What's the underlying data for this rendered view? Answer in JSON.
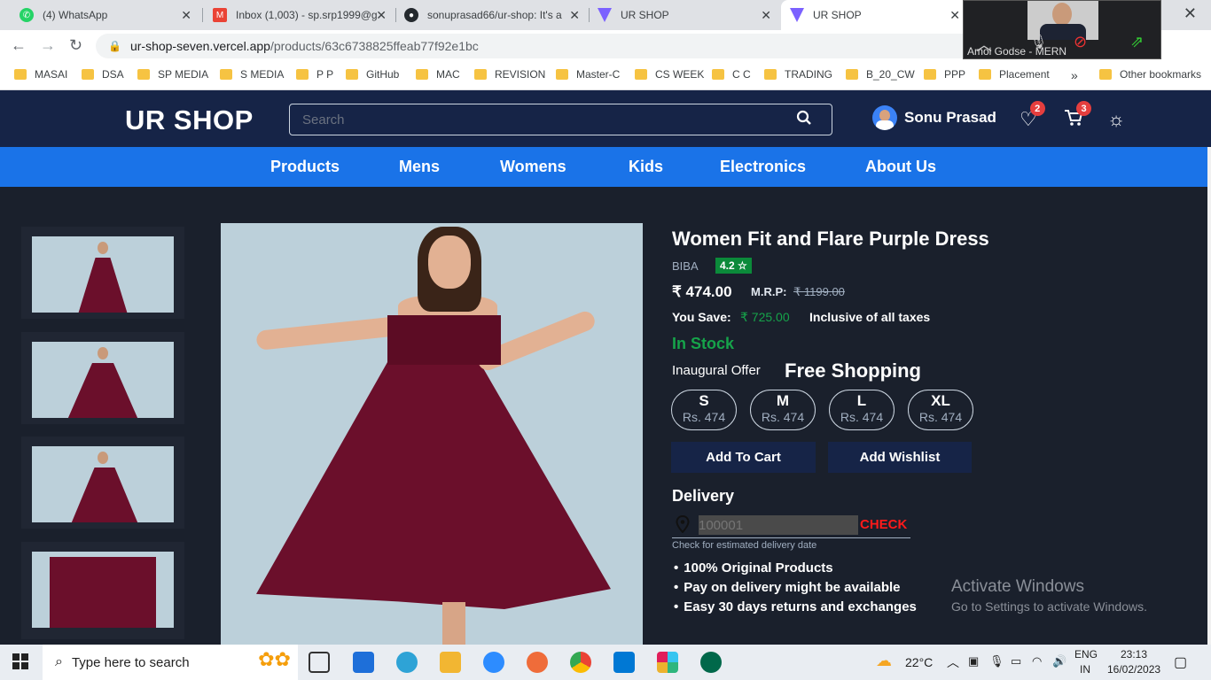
{
  "browser": {
    "tabs": [
      {
        "title": "(4) WhatsApp",
        "favicon_color": "#25d366"
      },
      {
        "title": "Inbox (1,003) - sp.srp1999@g",
        "favicon_color": "#ea4335"
      },
      {
        "title": "sonuprasad66/ur-shop: It's a",
        "favicon_color": "#24292e"
      },
      {
        "title": "UR SHOP",
        "favicon_color": "#7b61ff"
      },
      {
        "title": "UR SHOP",
        "favicon_color": "#7b61ff"
      }
    ],
    "url_host": "ur-shop-seven.vercel.app",
    "url_path": "/products/63c6738825ffeab77f92e1bc",
    "bookmarks": [
      "MASAI",
      "DSA",
      "SP MEDIA",
      "S MEDIA",
      "P P",
      "GitHub",
      "MAC",
      "REVISION",
      "Master-C",
      "CS WEEK",
      "C C",
      "TRADING",
      "B_20_CW",
      "PPP",
      "Placement"
    ],
    "overflow": "»",
    "other_bookmarks": "Other bookmarks"
  },
  "video_overlay": {
    "name": "Amol Godse - MERN"
  },
  "header": {
    "logo": "UR SHOP",
    "search_placeholder": "Search",
    "user_name": "Sonu Prasad",
    "wishlist_count": "2",
    "cart_count": "3"
  },
  "nav": [
    "Products",
    "Mens",
    "Womens",
    "Kids",
    "Electronics",
    "About Us"
  ],
  "product": {
    "title": "Women Fit and Flare Purple Dress",
    "brand": "BIBA",
    "rating": "4.2 ☆",
    "price": "₹ 474.00",
    "mrp_label": "M.R.P:",
    "mrp": "₹ 1199.00",
    "save_label": "You Save:",
    "save_value": "₹ 725.00",
    "taxes": "Inclusive of all taxes",
    "stock": "In Stock",
    "offer_label": "Inaugural Offer",
    "offer_value": "Free Shopping",
    "sizes": [
      {
        "size": "S",
        "price": "Rs. 474"
      },
      {
        "size": "M",
        "price": "Rs. 474"
      },
      {
        "size": "L",
        "price": "Rs. 474"
      },
      {
        "size": "XL",
        "price": "Rs. 474"
      }
    ],
    "add_to_cart": "Add To Cart",
    "add_wishlist": "Add Wishlist",
    "delivery_title": "Delivery",
    "pincode_placeholder": "100001",
    "check_label": "CHECK",
    "delivery_hint": "Check for estimated delivery date",
    "features": [
      "100% Original Products",
      "Pay on delivery might be available",
      "Easy 30 days returns and exchanges"
    ],
    "colors": {
      "dress": "#6b0f2b",
      "backdrop": "#bcd0da"
    }
  },
  "watermark": {
    "line1": "Activate Windows",
    "line2": "Go to Settings to activate Windows."
  },
  "taskbar": {
    "search_text": "Type here to search",
    "weather": "22°C",
    "lang1": "ENG",
    "lang2": "IN",
    "time": "23:13",
    "date": "16/02/2023"
  }
}
